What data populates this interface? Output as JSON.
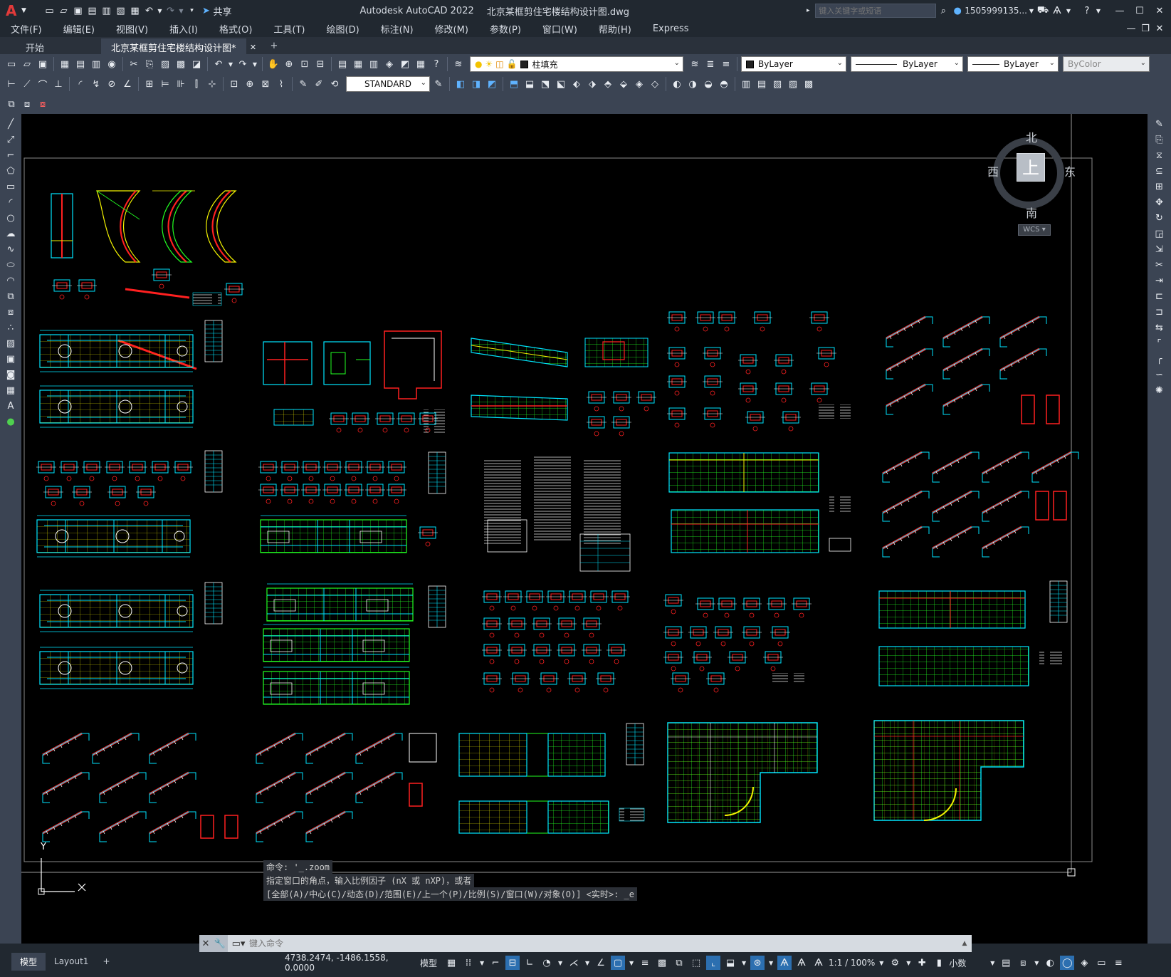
{
  "app": {
    "logo": "A",
    "title": "Autodesk AutoCAD 2022",
    "filename": "北京某框剪住宅楼结构设计图.dwg",
    "share_label": "共享",
    "search_placeholder": "键入关键字或短语",
    "user": "1505999135...",
    "window_controls": [
      "minimize-icon",
      "maximize-icon",
      "close-icon"
    ]
  },
  "menu": [
    "文件(F)",
    "编辑(E)",
    "视图(V)",
    "插入(I)",
    "格式(O)",
    "工具(T)",
    "绘图(D)",
    "标注(N)",
    "修改(M)",
    "参数(P)",
    "窗口(W)",
    "帮助(H)",
    "Express"
  ],
  "tabs": {
    "start": "开始",
    "active": "北京某框剪住宅楼结构设计图*",
    "add": "+"
  },
  "properties": {
    "layer": "柱填充",
    "color": "ByLayer",
    "linetype": "ByLayer",
    "lineweight": "ByLayer",
    "plotstyle": "ByColor"
  },
  "dimstyle": "STANDARD",
  "viewcube": {
    "north": "北",
    "south": "南",
    "east": "东",
    "west": "西",
    "face": "上",
    "wcs": "WCS"
  },
  "ucs": {
    "y": "Y"
  },
  "command_history": [
    "命令: '_.zoom",
    "指定窗口的角点，输入比例因子 (nX 或 nXP)，或者",
    "[全部(A)/中心(C)/动态(D)/范围(E)/上一个(P)/比例(S)/窗口(W)/对象(O)] <实时>: _e"
  ],
  "command_placeholder": "键入命令",
  "layout_tabs": [
    "模型",
    "Layout1"
  ],
  "status": {
    "coords": "4738.2474, -1486.1558, 0.0000",
    "space": "模型",
    "scale": "1:1 / 100%",
    "units": "小数"
  },
  "colors": {
    "canvas_bg": "#000000",
    "cyan": "#00e5ff",
    "green": "#22ff22",
    "yellow": "#f3f300",
    "red": "#ff2020",
    "white": "#ffffff"
  }
}
